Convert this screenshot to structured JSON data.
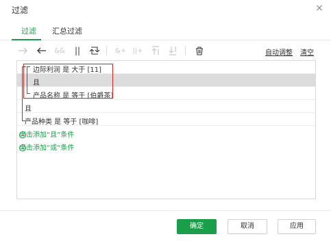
{
  "dialog": {
    "title": "过滤",
    "close_glyph": "×"
  },
  "tabs": [
    {
      "label": "过滤",
      "active": true
    },
    {
      "label": "汇总过滤",
      "active": false
    }
  ],
  "toolbar": {
    "icons": [
      "arrow-right-icon",
      "arrow-left-icon",
      "and-icon",
      "or-icon",
      "swap-icon",
      "add-and-icon",
      "add-or-icon",
      "move-up-icon",
      "move-down-icon",
      "delete-icon"
    ],
    "and_glyph": "&&",
    "or_glyph": "||",
    "add_and_glyph": "&+",
    "add_or_glyph": "||+",
    "auto_adjust": "自动调整",
    "clear": "清空"
  },
  "filter": {
    "rows": [
      {
        "text": "边际利润 是 大于 [11]"
      },
      {
        "text": "且"
      },
      {
        "text": "产品名称 是 等于 [伯爵茶]"
      },
      {
        "text": "且"
      },
      {
        "text": "产品种类 是 等于 [咖啡]"
      }
    ],
    "add_and": "点击添加“且”条件",
    "add_or": "点击添加“或”条件"
  },
  "buttons": {
    "ok": "确定",
    "cancel": "取消",
    "apply": "应用"
  },
  "colors": {
    "accent": "#1a9e4a",
    "highlight_box": "#e02020",
    "selected_row": "#dcdcdc"
  }
}
